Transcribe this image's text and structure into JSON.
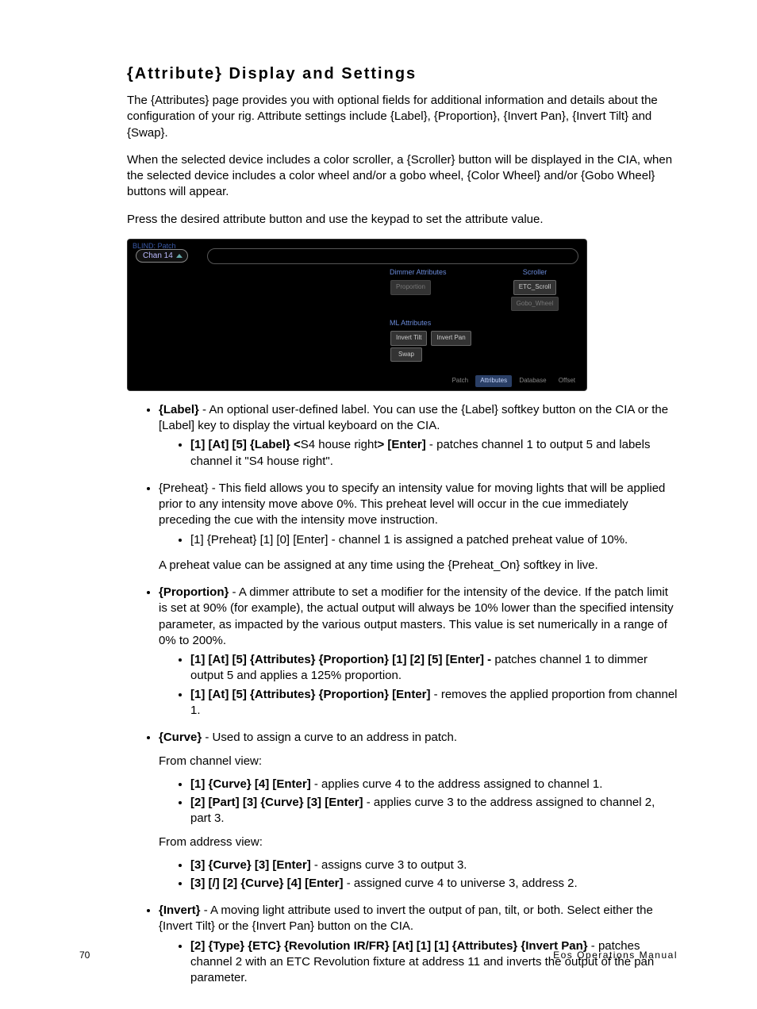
{
  "heading": "{Attribute} Display and Settings",
  "p1": "The {Attributes} page provides you with optional fields for additional information and details about the configuration of your rig. Attribute settings include {Label}, {Proportion}, {Invert Pan}, {Invert Tilt} and {Swap}.",
  "p2": "When the selected device includes a color scroller, a {Scroller} button will be displayed in the CIA, when the selected device includes a color wheel and/or a gobo wheel, {Color Wheel} and/or {Gobo Wheel} buttons will appear.",
  "p3": "Press the desired attribute button and use the keypad to set the attribute value.",
  "fig": {
    "blind": "BLIND: Patch",
    "chan": "Chan 14",
    "dim_label": "Dimmer Attributes",
    "prop_btn": "Proportion",
    "ml_label": "ML Attributes",
    "invert_tilt": "Invert Tilt",
    "invert_pan": "Invert Pan",
    "swap": "Swap",
    "scroller_section": "Scroller",
    "etc_scroll": "ETC_Scroll",
    "gobo_wheel": "Gobo_Wheel",
    "tab_patch": "Patch",
    "tab_attr": "Attributes",
    "tab_db": "Database",
    "tab_offset": "Offset"
  },
  "label_lead": "{Label}",
  "label_body": " - An optional user-defined label. You can use the {Label} softkey button on the CIA or the [Label] key to display the virtual keyboard on the CIA.",
  "label_ex_lead": "[1] [At] [5] {Label} <",
  "label_ex_mid": "S4 house right",
  "label_ex_bold2": "> [Enter]",
  "label_ex_tail": " - patches channel 1 to output 5 and labels channel it \"S4 house right\".",
  "preheat_body": "{Preheat} - This field allows you to specify an intensity value for moving lights that will be applied prior to any intensity move above 0%. This preheat level will occur in the cue immediately preceding the cue with the intensity move instruction.",
  "preheat_ex": "[1] {Preheat} [1] [0] [Enter] - channel 1 is assigned a patched preheat value of 10%.",
  "preheat_note": "A preheat value can be assigned at any time using the {Preheat_On} softkey in live.",
  "prop_lead": "{Proportion}",
  "prop_body": " - A dimmer attribute to set a modifier for the intensity of the device. If the patch limit is set at 90% (for example), the actual output will always be 10% lower than the specified intensity parameter, as impacted by the various output masters. This value is set numerically in a range of 0% to 200%.",
  "prop_ex1_b": "[1] [At] [5] {Attributes} {Proportion} [1] [2] [5] [Enter] - ",
  "prop_ex1_t": "patches channel 1 to dimmer output 5 and applies a 125% proportion.",
  "prop_ex2_b": "[1] [At] [5] {Attributes} {Proportion} [Enter]",
  "prop_ex2_t": " - removes the applied proportion from channel 1.",
  "curve_lead": "{Curve}",
  "curve_body": " - Used to assign a curve to an address in patch.",
  "curve_ch_view": "From channel view:",
  "curve_ex1_b": "[1] {Curve} [4] [Enter]",
  "curve_ex1_t": " - applies curve 4 to the address assigned to channel 1.",
  "curve_ex2_b": "[2] [Part] [3] {Curve} [3] [Enter]",
  "curve_ex2_t": " - applies curve 3 to the address assigned to channel 2, part 3.",
  "curve_addr_view": "From address view:",
  "curve_ex3_b": "[3] {Curve} [3] [Enter]",
  "curve_ex3_t": " - assigns curve 3 to output 3.",
  "curve_ex4_b": "[3] [/] [2] {Curve} [4] [Enter]",
  "curve_ex4_t": " - assigned curve 4 to universe 3, address 2.",
  "invert_lead": "{Invert}",
  "invert_body": " - A moving light attribute used to invert the output of pan, tilt, or both. Select either the {Invert Tilt} or the {Invert Pan} button on the CIA.",
  "invert_ex_b": "[2] {Type} {ETC} {Revolution IR/FR} [At] [1] [1] {Attributes} {Invert Pan}",
  "invert_ex_t": " - patches channel 2 with an ETC Revolution fixture at address 11 and inverts the output of the pan parameter.",
  "footer_page": "70",
  "footer_title": "Eos Operations Manual"
}
